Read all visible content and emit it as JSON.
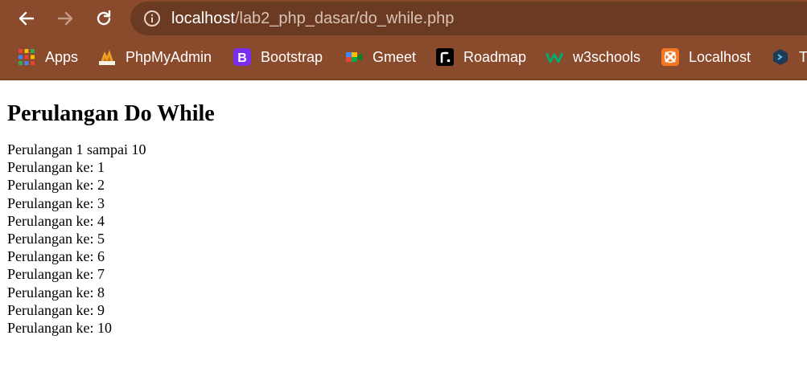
{
  "browser": {
    "url_host": "localhost",
    "url_path": "/lab2_php_dasar/do_while.php"
  },
  "bookmarks": [
    {
      "label": "Apps",
      "icon": "apps-grid-icon"
    },
    {
      "label": "PhpMyAdmin",
      "icon": "phpmyadmin-icon"
    },
    {
      "label": "Bootstrap",
      "icon": "bootstrap-icon"
    },
    {
      "label": "Gmeet",
      "icon": "gmeet-icon"
    },
    {
      "label": "Roadmap",
      "icon": "roadmap-icon"
    },
    {
      "label": "w3schools",
      "icon": "w3schools-icon"
    },
    {
      "label": "Localhost",
      "icon": "xampp-icon"
    },
    {
      "label": "Tr",
      "icon": "bookmark-icon"
    }
  ],
  "page": {
    "heading": "Perulangan Do While",
    "lines": [
      "Perulangan 1 sampai 10",
      "Perulangan ke: 1",
      "Perulangan ke: 2",
      "Perulangan ke: 3",
      "Perulangan ke: 4",
      "Perulangan ke: 5",
      "Perulangan ke: 6",
      "Perulangan ke: 7",
      "Perulangan ke: 8",
      "Perulangan ke: 9",
      "Perulangan ke: 10"
    ]
  }
}
